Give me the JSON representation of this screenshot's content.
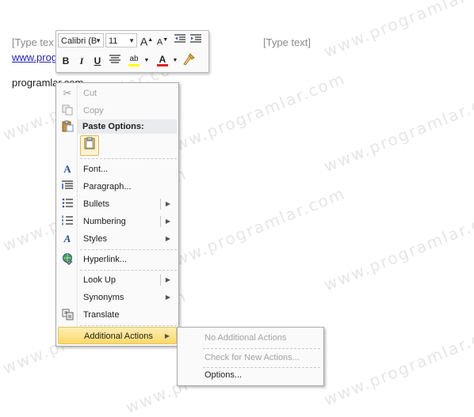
{
  "document": {
    "header_left": "[Type tex",
    "header_right": "[Type text]",
    "link_text": "www.prog",
    "body_text": "programlar.com"
  },
  "watermark": "www.programlar.com",
  "mini_toolbar": {
    "font_name": "Calibri (B",
    "font_size": "11",
    "grow_font": "A",
    "shrink_font": "A",
    "bold": "B",
    "italic": "I",
    "underline": "U",
    "highlight": "ab",
    "font_color": "A",
    "highlight_color": "#ffff00",
    "font_color_value": "#e02020"
  },
  "context_menu": {
    "items": {
      "cut": "Cut",
      "copy": "Copy",
      "paste_options": "Paste Options:",
      "font": "Font...",
      "paragraph": "Paragraph...",
      "bullets": "Bullets",
      "numbering": "Numbering",
      "styles": "Styles",
      "hyperlink": "Hyperlink...",
      "look_up": "Look Up",
      "synonyms": "Synonyms",
      "translate": "Translate",
      "additional_actions": "Additional Actions"
    }
  },
  "submenu": {
    "no_actions": "No Additional Actions",
    "check_actions": "Check for New Actions...",
    "options": "Options..."
  }
}
